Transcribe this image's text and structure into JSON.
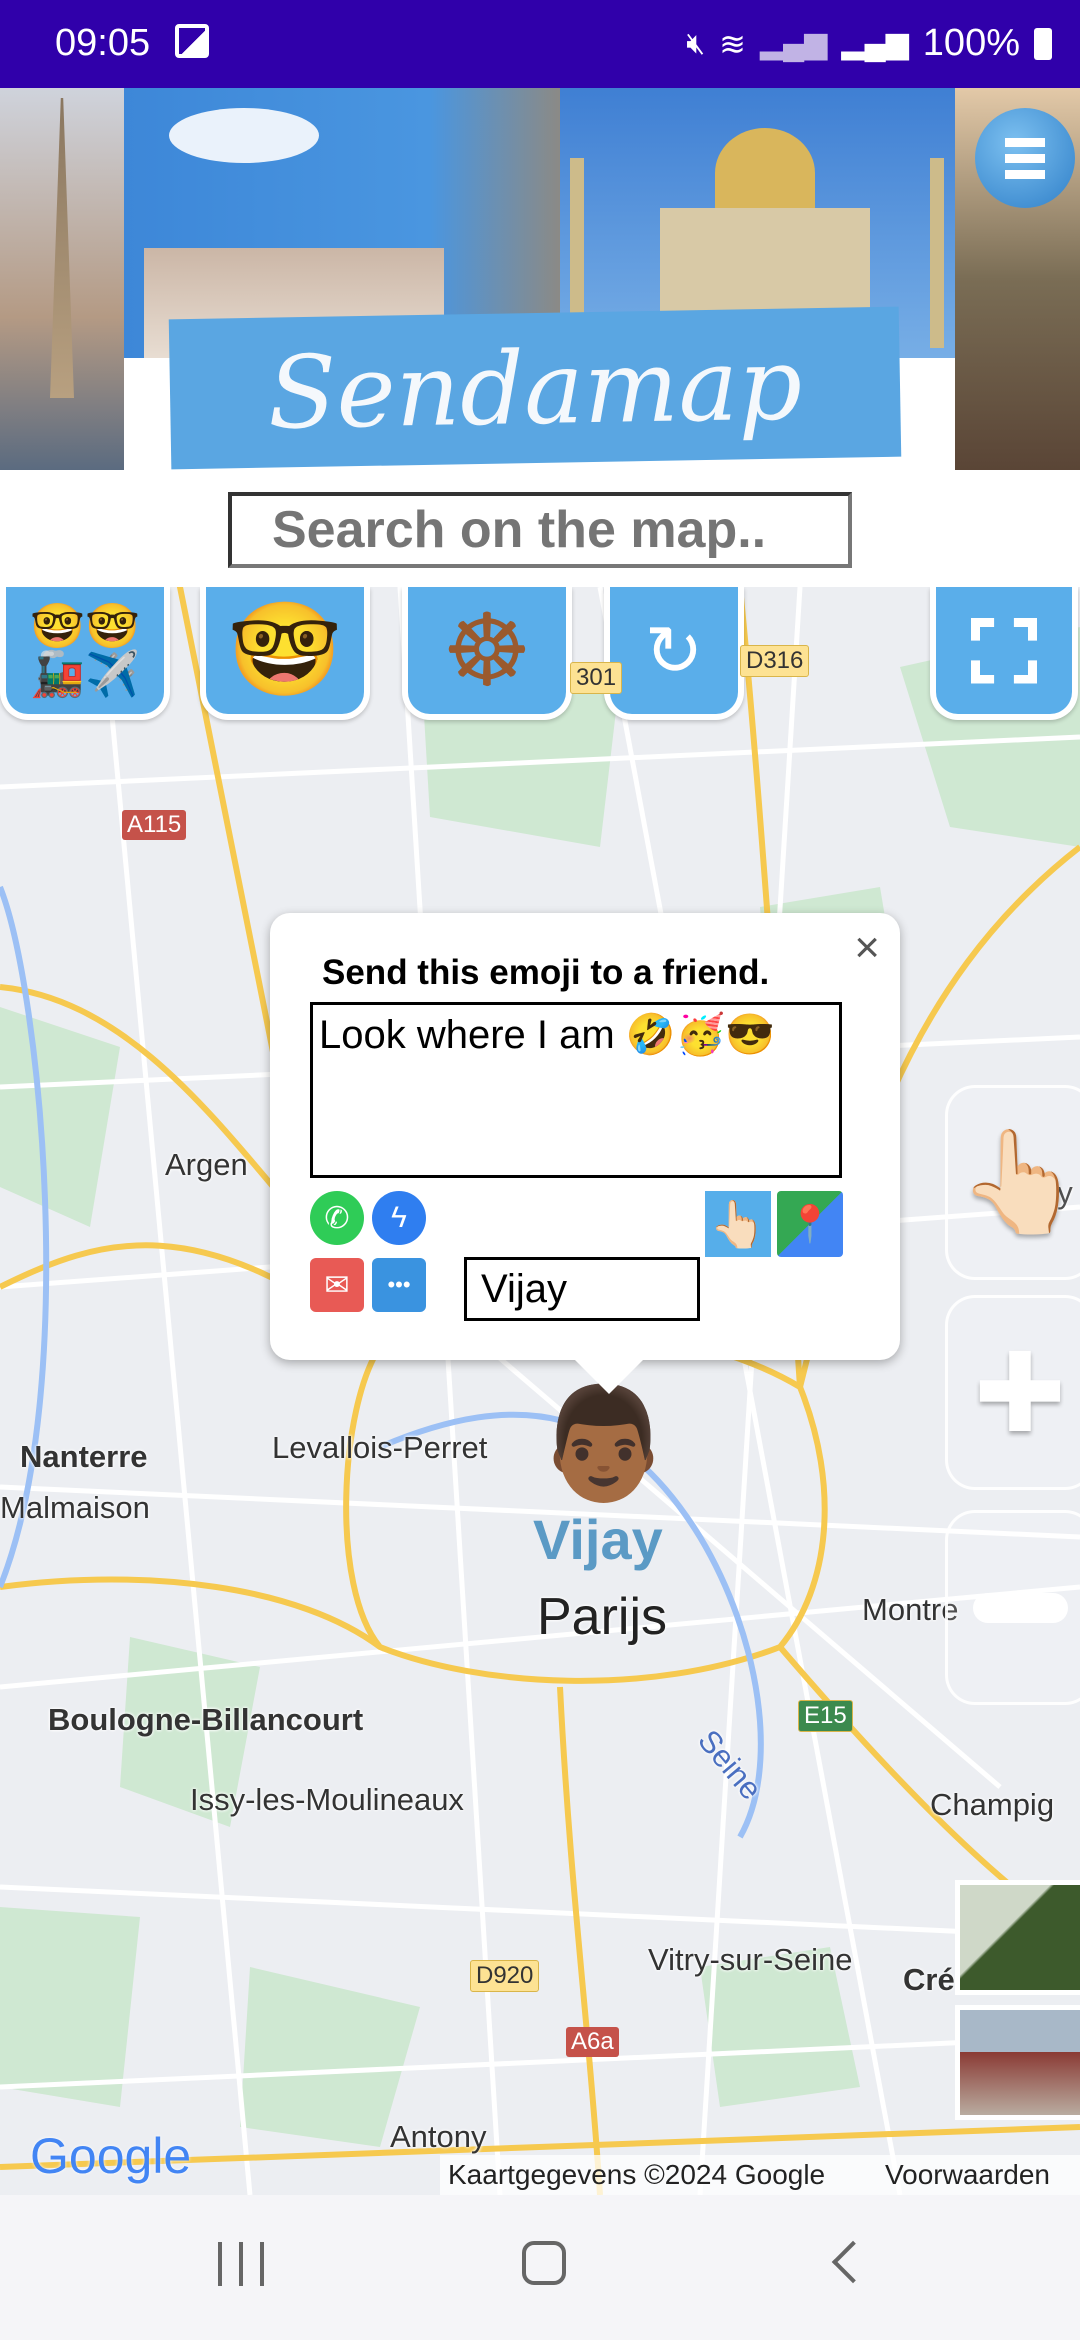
{
  "status_bar": {
    "time": "09:05",
    "battery": "100%",
    "icons": [
      "image-icon",
      "mute-icon",
      "wifi-icon",
      "signal-icon",
      "signal-roaming-icon",
      "battery-icon"
    ]
  },
  "banner": {
    "logo_text": "Sendamap",
    "menu_icon": "hamburger-menu-icon"
  },
  "search": {
    "placeholder": "Search on the map.."
  },
  "toolbar": {
    "buttons": [
      {
        "icon": "emoji-transport-icon"
      },
      {
        "icon": "nerd-emoji-icon"
      },
      {
        "icon": "ship-wheel-icon"
      },
      {
        "icon": "refresh-icon"
      },
      {
        "icon": "fullscreen-icon"
      }
    ]
  },
  "map": {
    "labels": {
      "argen": "Argen",
      "nanterre": "Nanterre",
      "malmaison": "Malmaison",
      "levallois": "Levallois-Perret",
      "boulogne": "Boulogne-Billancourt",
      "issy": "Issy-les-Moulineaux",
      "vitry": "Vitry-sur-Seine",
      "antony": "Antony",
      "montre": "Montre",
      "champig": "Champig",
      "cre": "Cré",
      "seine": "Seine",
      "city": "Parijs",
      "ay": "ay"
    },
    "shields": {
      "a115": "A115",
      "d316": "D316",
      "b301": "301",
      "e15": "E15",
      "d920": "D920",
      "a6a": "A6a"
    },
    "marker": {
      "emoji": "👨🏾",
      "name": "Vijay",
      "name_color": "#5b9ac5"
    },
    "attribution": "Kaartgegevens ©2024 Google",
    "terms": "Voorwaarden",
    "google_logo": "Google"
  },
  "popup": {
    "title": "Send this emoji to a friend.",
    "message": "Look where I am 🤣🥳😎",
    "name_value": "Vijay",
    "share_icons": [
      "whatsapp-icon",
      "messenger-icon",
      "email-icon",
      "sms-icon",
      "pointing-hand-icon",
      "google-maps-icon"
    ]
  },
  "side_controls": [
    "hand-pointer-icon",
    "plus-icon",
    "minus-icon"
  ],
  "nav_bar": [
    "recent-apps-icon",
    "home-icon",
    "back-icon"
  ]
}
